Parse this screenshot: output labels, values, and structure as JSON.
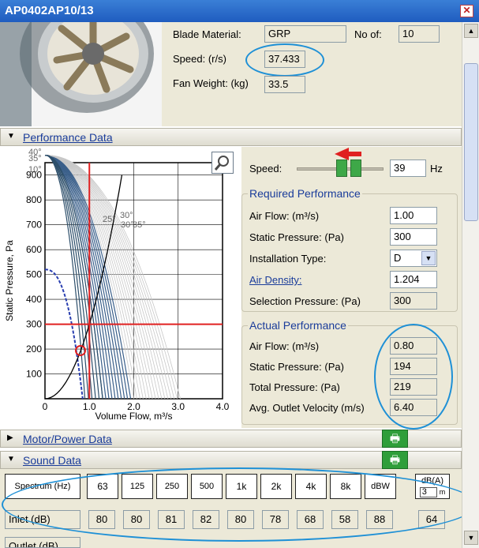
{
  "window": {
    "title": "AP0402AP10/13",
    "close_glyph": "✕"
  },
  "header": {
    "blade_material_label": "Blade Material:",
    "blade_material_value": "GRP",
    "no_of_label": "No of:",
    "no_of_value": "10",
    "speed_label": "Speed: (r/s)",
    "speed_value": "37.433",
    "fan_weight_label": "Fan Weight: (kg)",
    "fan_weight_value": "33.5"
  },
  "performance": {
    "section_title": "Performance Data",
    "speed_label": "Speed:",
    "speed_value": "39",
    "speed_unit": "Hz",
    "required": {
      "title": "Required Performance",
      "air_flow_label": "Air Flow: (m³/s)",
      "air_flow_value": "1.00",
      "static_pressure_label": "Static Pressure: (Pa)",
      "static_pressure_value": "300",
      "installation_type_label": "Installation Type:",
      "installation_type_value": "D",
      "air_density_label": "Air Density:",
      "air_density_value": "1.204",
      "selection_pressure_label": "Selection Pressure: (Pa)",
      "selection_pressure_value": "300"
    },
    "actual": {
      "title": "Actual Performance",
      "air_flow_label": "Air Flow: (m³/s)",
      "air_flow_value": "0.80",
      "static_pressure_label": "Static Pressure: (Pa)",
      "static_pressure_value": "194",
      "total_pressure_label": "Total Pressure: (Pa)",
      "total_pressure_value": "219",
      "outlet_velocity_label": "Avg. Outlet Velocity (m/s)",
      "outlet_velocity_value": "6.40"
    }
  },
  "chart_data": {
    "type": "line",
    "xlabel": "Volume Flow, m³/s",
    "ylabel": "Static Pressure, Pa",
    "xlim": [
      0,
      4.0
    ],
    "ylim": [
      0,
      950
    ],
    "x_ticks": [
      "0",
      "1.0",
      "2.0",
      "3.0",
      "4.0"
    ],
    "y_ticks": [
      "100",
      "200",
      "300",
      "400",
      "500",
      "600",
      "700",
      "800",
      "900"
    ],
    "angle_labels": [
      "40°",
      "35°",
      "10°",
      "25°",
      "30°",
      "35°",
      "30°"
    ],
    "selection_point": {
      "x": 0.8,
      "y": 194
    },
    "required_point": {
      "x": 1.0,
      "y": 300
    }
  },
  "sections": {
    "motor_power_title": "Motor/Power Data",
    "sound_title": "Sound Data"
  },
  "sound": {
    "spectrum_label": "Spectrum (Hz)",
    "bands": [
      "63",
      "125",
      "250",
      "500",
      "1k",
      "2k",
      "4k",
      "8k",
      "dBW"
    ],
    "dba_label": "dB(A)",
    "dba_distance": "3",
    "dba_unit": "m",
    "inlet_label": "Inlet (dB)",
    "inlet_values": [
      "80",
      "80",
      "81",
      "82",
      "80",
      "78",
      "68",
      "58",
      "88",
      "64"
    ],
    "outlet_label": "Outlet (dB)"
  },
  "icons": {
    "print": "🖶",
    "zoom": "magnifier-icon"
  }
}
